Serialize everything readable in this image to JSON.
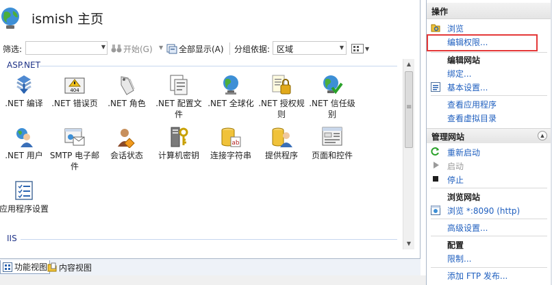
{
  "header": {
    "title": "ismish 主页"
  },
  "toolbar": {
    "filter_label": "筛选:",
    "start_label": "开始(G)",
    "show_all_label": "全部显示(A)",
    "group_by_label": "分组依据:",
    "group_by_value": "区域"
  },
  "groups": [
    {
      "name": "ASP.NET",
      "items": [
        {
          "label": ".NET 编译",
          "icon": "net-compile-icon"
        },
        {
          "label": ".NET 错误页",
          "icon": "net-error-pages-icon"
        },
        {
          "label": ".NET 角色",
          "icon": "net-roles-icon"
        },
        {
          "label": ".NET 配置文件",
          "icon": "net-profile-icon"
        },
        {
          "label": ".NET 全球化",
          "icon": "net-globalization-icon"
        },
        {
          "label": ".NET 授权规则",
          "icon": "net-authorization-icon"
        },
        {
          "label": ".NET 信任级别",
          "icon": "net-trust-levels-icon"
        },
        {
          "label": ".NET 用户",
          "icon": "net-users-icon"
        },
        {
          "label": "SMTP 电子邮件",
          "icon": "smtp-email-icon"
        },
        {
          "label": "会话状态",
          "icon": "session-state-icon"
        },
        {
          "label": "计算机密钥",
          "icon": "machine-key-icon"
        },
        {
          "label": "连接字符串",
          "icon": "connection-strings-icon"
        },
        {
          "label": "提供程序",
          "icon": "providers-icon"
        },
        {
          "label": "页面和控件",
          "icon": "pages-controls-icon"
        },
        {
          "label": "应用程序设置",
          "icon": "app-settings-icon"
        }
      ]
    },
    {
      "name": "IIS",
      "items": []
    }
  ],
  "bottom_tabs": [
    {
      "label": "功能视图",
      "active": true,
      "icon": "features-view-icon"
    },
    {
      "label": "内容视图",
      "active": false,
      "icon": "content-view-icon"
    }
  ],
  "actions": {
    "header": "操作",
    "browse": "浏览",
    "edit_permissions": "编辑权限...",
    "edit_site_title": "编辑网站",
    "bindings": "绑定...",
    "basic_settings": "基本设置...",
    "view_applications": "查看应用程序",
    "view_virtual_dirs": "查看虚拟目录",
    "manage_site_title": "管理网站",
    "restart": "重新启动",
    "start": "启动",
    "stop": "停止",
    "browse_site_title": "浏览网站",
    "browse_port": "浏览 *:8090 (http)",
    "advanced_settings": "高级设置...",
    "config_title": "配置",
    "limits": "限制...",
    "add_ftp": "添加 FTP 发布..."
  },
  "colors": {
    "link": "#1f5fbf",
    "group_header": "#1e3287",
    "highlight_border": "#e43737"
  }
}
